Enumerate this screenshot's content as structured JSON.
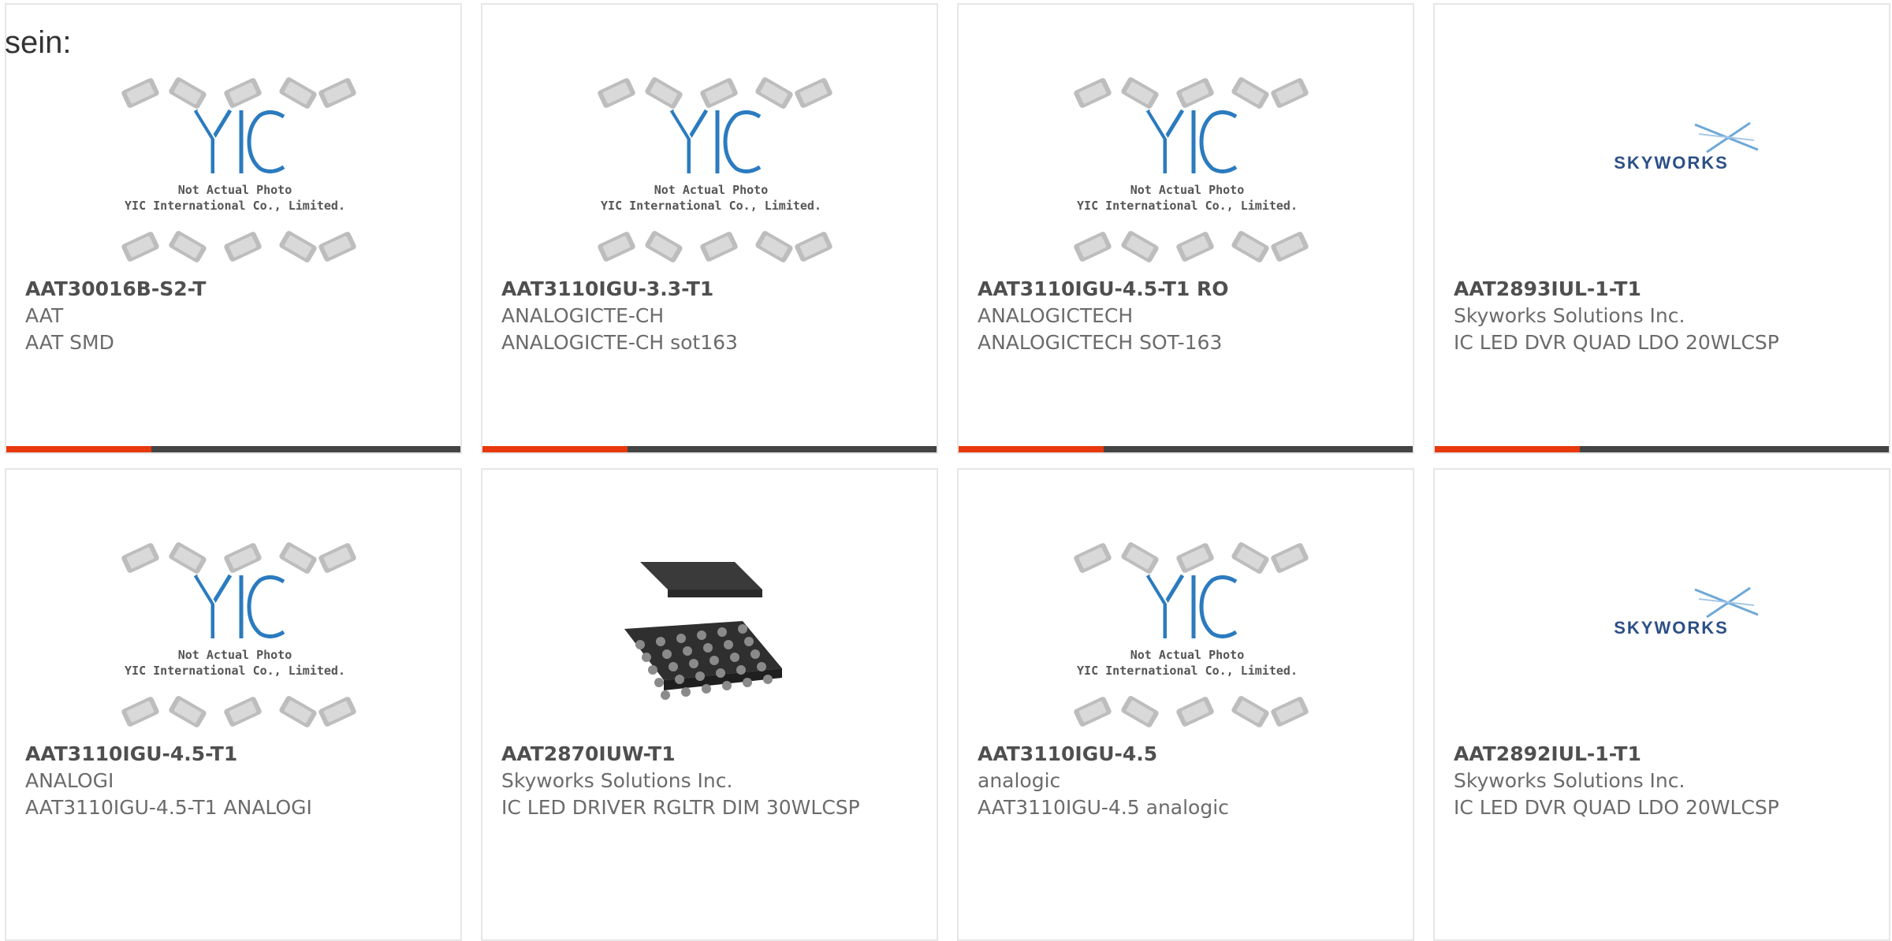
{
  "intro_text": "sein:",
  "accent_color": "#e8380d",
  "cards": [
    {
      "part": "AAT30016B-S2-T",
      "maker": "AAT",
      "desc": "AAT SMD",
      "image": "yic-placeholder",
      "img_caption_1": "Not Actual Photo",
      "img_caption_2": "YIC International Co., Limited."
    },
    {
      "part": "AAT3110IGU-3.3-T1",
      "maker": "ANALOGICTE-CH",
      "desc": "ANALOGICTE-CH sot163",
      "image": "yic-placeholder",
      "img_caption_1": "Not Actual Photo",
      "img_caption_2": "YIC International Co., Limited."
    },
    {
      "part": "AAT3110IGU-4.5-T1 RO",
      "maker": "ANALOGICTECH",
      "desc": "ANALOGICTECH SOT-163",
      "image": "yic-placeholder",
      "img_caption_1": "Not Actual Photo",
      "img_caption_2": "YIC International Co., Limited."
    },
    {
      "part": "AAT2893IUL-1-T1",
      "maker": "Skyworks Solutions Inc.",
      "desc": "IC LED DVR QUAD LDO 20WLCSP",
      "image": "skyworks-logo",
      "logo_text": "SKYWORKS"
    },
    {
      "part": "AAT3110IGU-4.5-T1",
      "maker": "ANALOGI",
      "desc": "AAT3110IGU-4.5-T1 ANALOGI",
      "image": "yic-placeholder",
      "img_caption_1": "Not Actual Photo",
      "img_caption_2": "YIC International Co., Limited."
    },
    {
      "part": "AAT2870IUW-T1",
      "maker": "Skyworks Solutions Inc.",
      "desc": "IC LED DRIVER RGLTR DIM 30WLCSP",
      "image": "bga-chip-photo"
    },
    {
      "part": "AAT3110IGU-4.5",
      "maker": "analogic",
      "desc": "AAT3110IGU-4.5 analogic",
      "image": "yic-placeholder",
      "img_caption_1": "Not Actual Photo",
      "img_caption_2": "YIC International Co., Limited."
    },
    {
      "part": "AAT2892IUL-1-T1",
      "maker": "Skyworks Solutions Inc.",
      "desc": "IC LED DVR QUAD LDO 20WLCSP",
      "image": "skyworks-logo",
      "logo_text": "SKYWORKS"
    }
  ]
}
